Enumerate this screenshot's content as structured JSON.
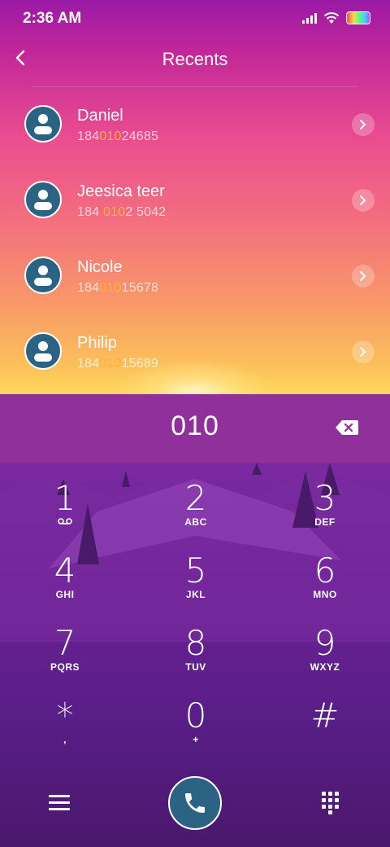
{
  "status_bar": {
    "time": "2:36 AM"
  },
  "header": {
    "title": "Recents"
  },
  "recents": [
    {
      "name": "Daniel",
      "number_parts": [
        "184",
        "010",
        "24685"
      ]
    },
    {
      "name": "Jeesica teer",
      "number_parts": [
        "184 ",
        "010",
        "2 5042"
      ]
    },
    {
      "name": "Nicole",
      "number_parts": [
        "184",
        "010",
        "15678"
      ]
    },
    {
      "name": "Philip",
      "number_parts": [
        "184",
        "010",
        "15689"
      ]
    }
  ],
  "dial_input": {
    "digits": "010"
  },
  "dialpad": [
    {
      "num": "1",
      "letters": "voicemail-icon"
    },
    {
      "num": "2",
      "letters": "ABC"
    },
    {
      "num": "3",
      "letters": "DEF"
    },
    {
      "num": "4",
      "letters": "GHI"
    },
    {
      "num": "5",
      "letters": "JKL"
    },
    {
      "num": "6",
      "letters": "MNO"
    },
    {
      "num": "7",
      "letters": "PQRS"
    },
    {
      "num": "8",
      "letters": "TUV"
    },
    {
      "num": "9",
      "letters": "WXYZ"
    },
    {
      "num": "*",
      "letters": ","
    },
    {
      "num": "0",
      "letters": "+"
    },
    {
      "num": "#",
      "letters": ""
    }
  ],
  "colors": {
    "accent": "#2b6385",
    "highlight": "#ffb13c",
    "input_bar": "#90309a"
  },
  "icons": [
    "back-icon",
    "chevron-right-icon",
    "backspace-icon",
    "menu-icon",
    "phone-icon",
    "dialpad-grid-icon",
    "voicemail-icon",
    "person-icon"
  ]
}
